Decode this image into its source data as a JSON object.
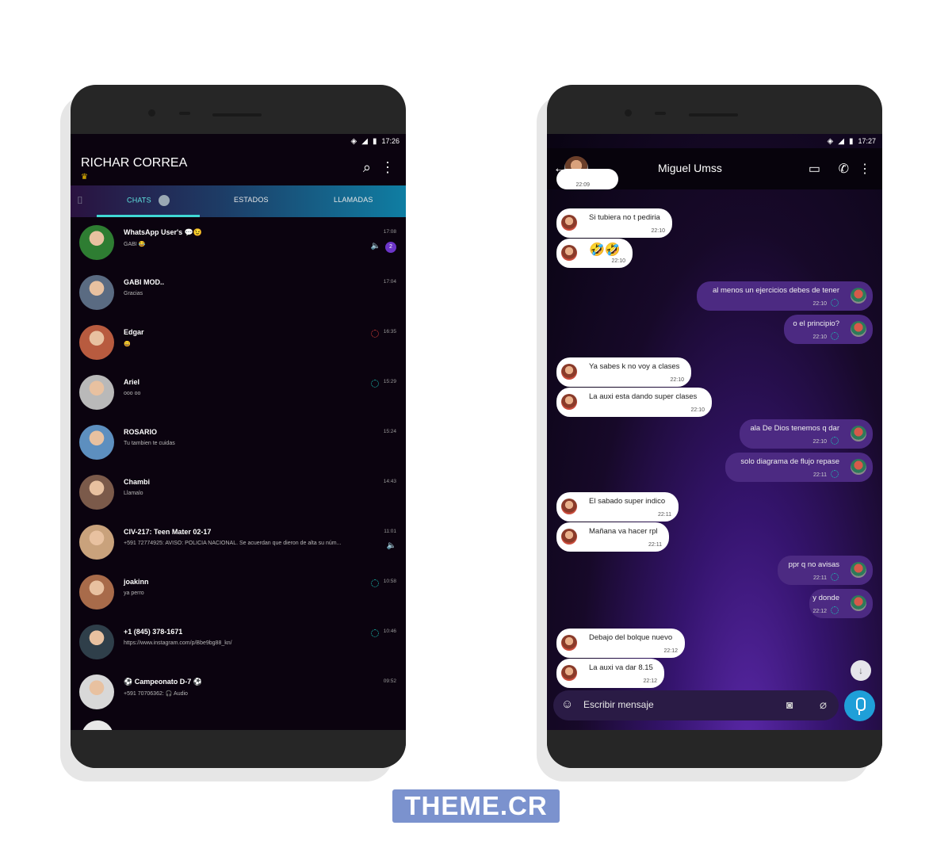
{
  "left_phone": {
    "status": {
      "time": "17:26"
    },
    "header": {
      "title": "RICHAR CORREA",
      "subtitle_icon": "crown-emoji"
    },
    "tabs": [
      {
        "label": "CHATS",
        "active": true
      },
      {
        "label": "ESTADOS",
        "active": false
      },
      {
        "label": "LLAMADAS",
        "active": false
      }
    ],
    "chats": [
      {
        "name": "WhatsApp User's 💬😉",
        "message": "GABI 😂",
        "time": "17:08",
        "unread": "2",
        "muted": true,
        "avatar_color": "#2e7d32"
      },
      {
        "name": "GABI MOD..",
        "message": "Gracias",
        "time": "17:04",
        "avatar_color": "#5a6b82"
      },
      {
        "name": "Edgar",
        "message": "😄",
        "time": "16:35",
        "status_ring": "red",
        "avatar_color": "#b85b3f"
      },
      {
        "name": "Ariel",
        "message": "ooo oo",
        "time": "15:29",
        "status_ring": "teal",
        "avatar_color": "#b9b9b9"
      },
      {
        "name": "ROSARIO",
        "message": "Tu tambien te cuidas",
        "time": "15:24",
        "avatar_color": "#5d8fbf"
      },
      {
        "name": "Chambi",
        "message": "Llamalo",
        "time": "14:43",
        "avatar_color": "#7b5a4a"
      },
      {
        "name": "CIV-217: Teen Mater 02-17",
        "message": "+591 72774925: AVISO: POLICIA NACIONAL. Se acuerdan que dieron de alta su núm...",
        "time": "11:01",
        "muted": true,
        "avatar_color": "#c9a27c"
      },
      {
        "name": "joakinn",
        "message": "ya perro",
        "time": "10:58",
        "status_ring": "teal",
        "avatar_color": "#a86b4a"
      },
      {
        "name": "+1 (845) 378-1671",
        "message": "https://www.instagram.com/p/Bbe9bg88_kn/",
        "time": "10:46",
        "status_ring": "teal",
        "avatar_color": "#2f3f4a"
      },
      {
        "name": "⚽ Campeonato D-7 ⚽",
        "message": "+591 70706362: 🎧 Audio",
        "time": "09:52",
        "avatar_color": "#d8d8d8"
      }
    ]
  },
  "right_phone": {
    "status": {
      "time": "17:27"
    },
    "header": {
      "contact_name": "Miguel Umss"
    },
    "messages": [
      {
        "dir": "in",
        "text": "",
        "time": "22:09"
      },
      {
        "dir": "in",
        "text": "Si tubiera no t pediria",
        "time": "22:10"
      },
      {
        "dir": "in",
        "text": "🤣🤣",
        "time": "22:10"
      },
      {
        "dir": "out",
        "text": "al menos un ejercicios debes de tener",
        "time": "22:10"
      },
      {
        "dir": "out",
        "text": "o el principio?",
        "time": "22:10"
      },
      {
        "dir": "in",
        "text": "Ya sabes k no voy a clases",
        "time": "22:10"
      },
      {
        "dir": "in",
        "text": "La auxi esta dando super clases",
        "time": "22:10"
      },
      {
        "dir": "out",
        "text": "ala De Dios tenemos q dar",
        "time": "22:10"
      },
      {
        "dir": "out",
        "text": "solo diagrama de flujo repase",
        "time": "22:11"
      },
      {
        "dir": "in",
        "text": "El sabado super indico",
        "time": "22:11"
      },
      {
        "dir": "in",
        "text": "Mañana va hacer rpl",
        "time": "22:11"
      },
      {
        "dir": "out",
        "text": "ppr q no avisas",
        "time": "22:11"
      },
      {
        "dir": "out",
        "text": "y donde",
        "time": "22:12"
      },
      {
        "dir": "in",
        "text": "Debajo del bolque nuevo",
        "time": "22:12"
      },
      {
        "dir": "in",
        "text": "La auxi va dar 8.15",
        "time": "22:12"
      }
    ],
    "composer": {
      "placeholder": "Escribir mensaje"
    }
  },
  "watermark": {
    "text": "THEME.CR"
  }
}
